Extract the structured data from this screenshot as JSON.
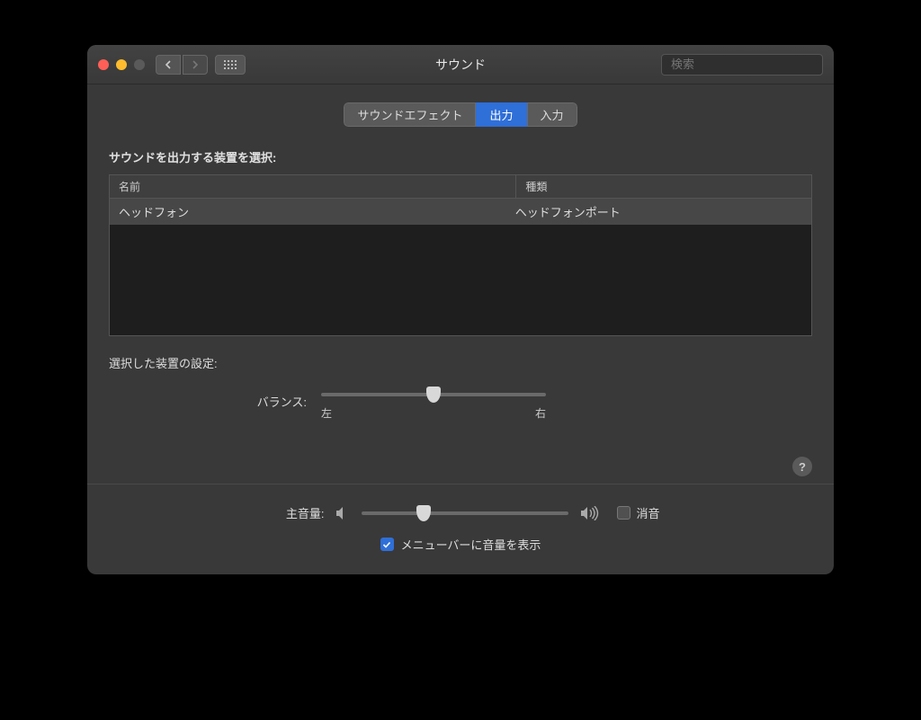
{
  "window": {
    "title": "サウンド"
  },
  "search": {
    "placeholder": "検索"
  },
  "tabs": {
    "effects": "サウンドエフェクト",
    "output": "出力",
    "input": "入力"
  },
  "device_list": {
    "heading": "サウンドを出力する装置を選択:",
    "col_name": "名前",
    "col_type": "種類",
    "row0_name": "ヘッドフォン",
    "row0_type": "ヘッドフォンポート"
  },
  "settings": {
    "heading": "選択した装置の設定:"
  },
  "balance": {
    "label": "バランス:",
    "left": "左",
    "right": "右",
    "value_pct": 50
  },
  "volume": {
    "label": "主音量:",
    "value_pct": 30,
    "mute_label": "消音",
    "show_in_menubar": "メニューバーに音量を表示"
  },
  "help": {
    "label": "?"
  }
}
